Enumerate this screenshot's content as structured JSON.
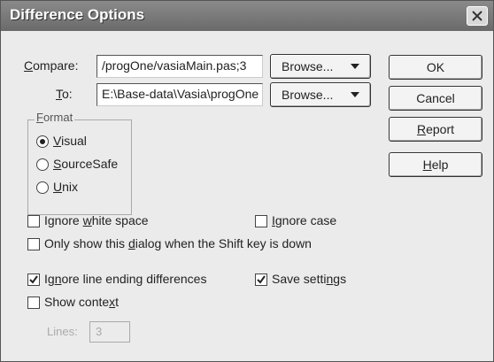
{
  "dialog": {
    "title": "Difference Options",
    "close_label": "×"
  },
  "compare": {
    "label_first": "C",
    "label_rest": "ompare:",
    "value": "/progOne/vasiaMain.pas;3",
    "browse_label": "Browse..."
  },
  "to": {
    "label_first": "T",
    "label_rest": "o:",
    "value": "E:\\Base-data\\Vasia\\progOne",
    "browse_label": "Browse..."
  },
  "buttons": {
    "ok": "OK",
    "cancel": "Cancel",
    "report_first": "R",
    "report_rest": "eport",
    "help_first": "H",
    "help_rest": "elp"
  },
  "format": {
    "title_first": "F",
    "title_rest": "ormat",
    "options": [
      {
        "first": "V",
        "rest": "isual",
        "selected": true
      },
      {
        "first": "S",
        "rest": "ourceSafe",
        "selected": false
      },
      {
        "first": "U",
        "rest": "nix",
        "selected": false
      }
    ]
  },
  "options": {
    "ignore_white_space": {
      "pre": "Ignore ",
      "u": "w",
      "post": "hite space",
      "checked": false
    },
    "ignore_case": {
      "pre": "",
      "u": "I",
      "post": "gnore case",
      "checked": false
    },
    "only_show": {
      "pre": "Only show this ",
      "u": "d",
      "post": "ialog when the Shift key is down",
      "checked": false
    },
    "ignore_line_endings": {
      "pre": "Ig",
      "u": "n",
      "post": "ore line ending differences",
      "checked": true
    },
    "save_settings": {
      "pre": "Save setti",
      "u": "n",
      "post": "gs",
      "checked": true
    },
    "show_context": {
      "pre": "Show conte",
      "u": "x",
      "post": "t",
      "checked": false
    }
  },
  "lines": {
    "label": "Lines:",
    "value": "3"
  }
}
